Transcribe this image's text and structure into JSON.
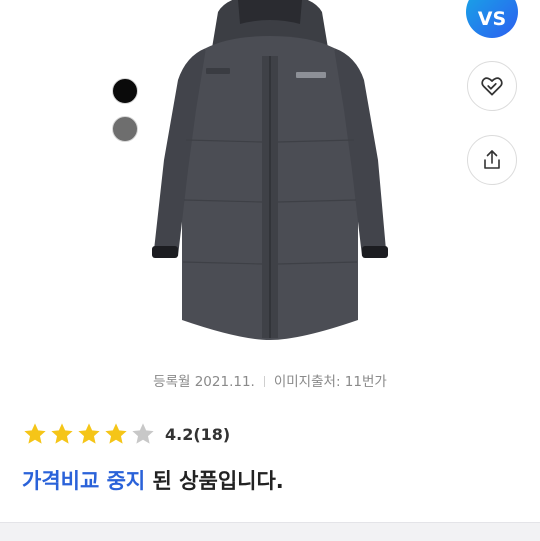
{
  "product": {
    "image_alt": "product-coat",
    "color_options": [
      {
        "name": "black",
        "color": "#0a0a0a"
      },
      {
        "name": "gray",
        "color": "#6e6e6e"
      }
    ]
  },
  "actions": {
    "vs_label": "VS",
    "wishlist_icon": "heart-check-icon",
    "share_icon": "share-icon"
  },
  "meta": {
    "registered": "등록월 2021.11.",
    "image_source": "이미지출처: 11번가"
  },
  "rating": {
    "value": 4.2,
    "filled_stars": 4,
    "max_stars": 5,
    "score_text": "4.2",
    "count_text": "(18)"
  },
  "notice": {
    "highlight": "가격비교 중지",
    "rest": "된 상품입니다."
  },
  "colors": {
    "accent": "#2a62d9",
    "star_filled": "#f5c518",
    "star_empty": "#c8c8c8"
  }
}
